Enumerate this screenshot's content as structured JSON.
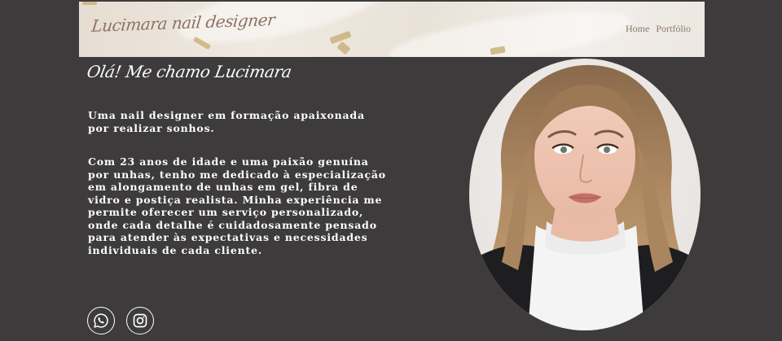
{
  "header": {
    "logo_text": "Lucimara nail designer",
    "nav": [
      {
        "label": "Home"
      },
      {
        "label": "Portfólio"
      }
    ]
  },
  "main": {
    "greeting": "Olá! Me chamo Lucimara",
    "intro": "Uma nail designer em formação apaixonada por realizar sonhos.",
    "about": "Com 23 anos de idade e uma paixão genuína por unhas, tenho me dedicado à especialização em alongamento de unhas em gel, fibra de vidro e postiça realista. Minha experiência me permite oferecer um serviço personalizado, onde cada detalhe é cuidadosamente pensado para atender às expectativas e necessidades individuais de cada cliente."
  },
  "social": [
    {
      "icon": "whatsapp-icon"
    },
    {
      "icon": "instagram-icon"
    }
  ],
  "colors": {
    "background": "#3d3b3c",
    "text": "#ffffff",
    "nav_text": "#8b7a6d",
    "logo_text": "#8b7360"
  }
}
